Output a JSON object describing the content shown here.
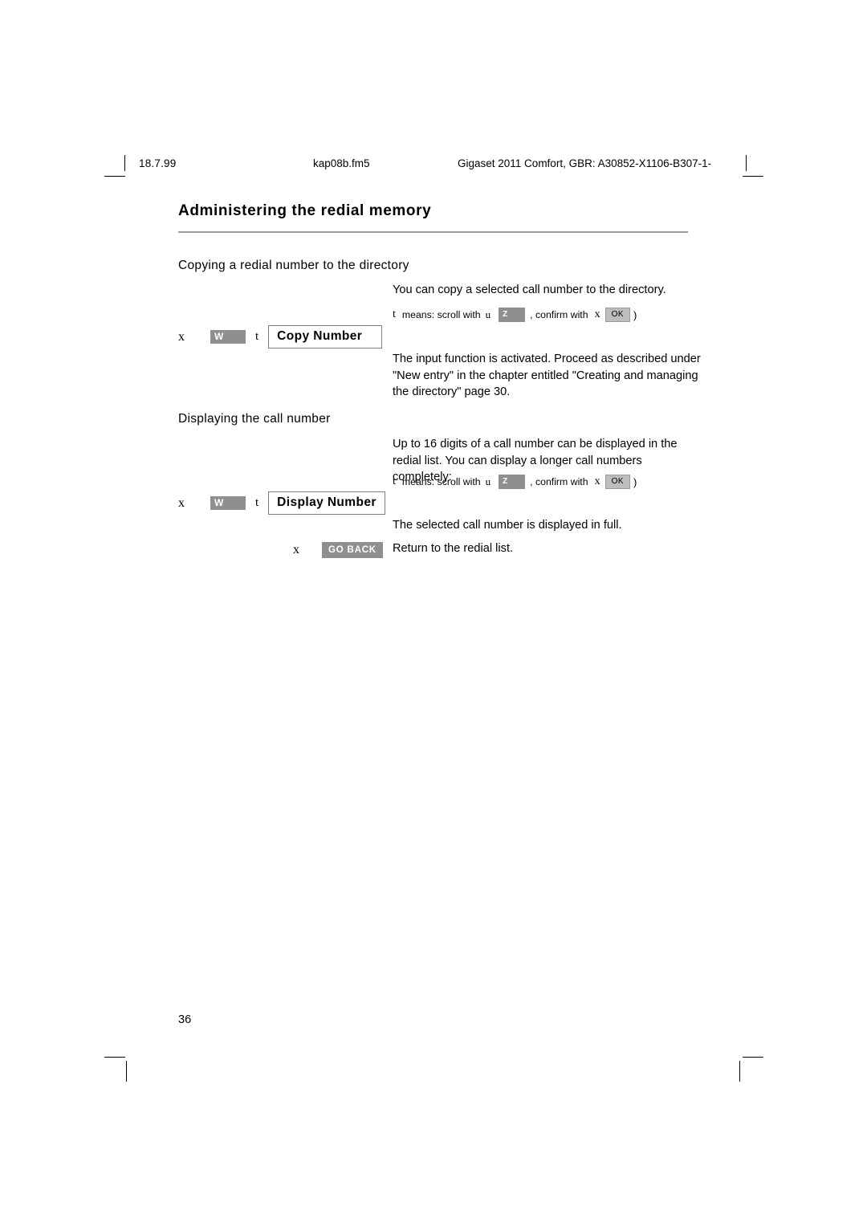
{
  "runhead": {
    "date": "18.7.99",
    "file": "kap08b.fm5",
    "doc": "Gigaset 2011 Comfort, GBR: A30852-X1106-B307-1-"
  },
  "page": {
    "chapter_title": "Administering the redial memory",
    "number": "36"
  },
  "sections": [
    {
      "heading": "Copying a redial number to the directory",
      "intro": "You can copy a selected call number to the directory.",
      "note": {
        "glyph": "t",
        "text_before": "means: scroll with",
        "scroll_glyph": "u",
        "key_label": "Z",
        "text_after": ", confirm with",
        "confirm_glyph": "x",
        "ok_label": "OK",
        "close_paren": ")"
      },
      "action": {
        "x_glyph": "x",
        "key_w": "W",
        "t_glyph": "t",
        "button": "Copy Number"
      },
      "after": "The input function is activated. Proceed as described under \"New entry\" in the chapter entitled \"Creating and managing the directory\"  page 30."
    },
    {
      "heading": "Displaying the call number",
      "intro": "Up to 16 digits of a call number can be displayed in the redial list. You can display a longer call numbers completely:",
      "note": {
        "glyph": "t",
        "text_before": "means: scroll with",
        "scroll_glyph": "u",
        "key_label": "Z",
        "text_after": ", confirm with",
        "confirm_glyph": "x",
        "ok_label": "OK",
        "close_paren": ")"
      },
      "action": {
        "x_glyph": "x",
        "key_w": "W",
        "t_glyph": "t",
        "button": "Display Number"
      },
      "after": "The selected call number is displayed in full.",
      "action2": {
        "x_glyph": "x",
        "key_goback": "GO BACK",
        "text": "Return to the redial list."
      }
    }
  ],
  "colors": {
    "key_gray": "#8f8f8f",
    "ok_gray": "#bdbdbd",
    "rule_gray": "#9a9a9a"
  }
}
